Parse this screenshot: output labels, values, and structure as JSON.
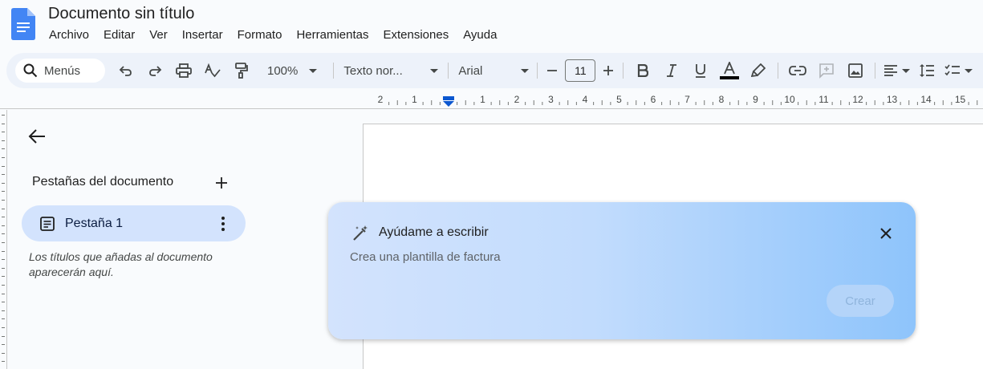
{
  "app": {
    "doc_title": "Documento sin título",
    "menu": [
      "Archivo",
      "Editar",
      "Ver",
      "Insertar",
      "Formato",
      "Herramientas",
      "Extensiones",
      "Ayuda"
    ]
  },
  "toolbar": {
    "search_placeholder": "Menús",
    "zoom": "100%",
    "style": "Texto nor...",
    "font": "Arial",
    "font_size": "11"
  },
  "ruler": {
    "labels": [
      "2",
      "1",
      "1",
      "2",
      "3",
      "4",
      "5",
      "6",
      "7",
      "8",
      "9",
      "10",
      "11",
      "12",
      "13",
      "14",
      "15"
    ]
  },
  "sidebar": {
    "tabs_title": "Pestañas del documento",
    "tab_label": "Pestaña 1",
    "hint": "Los títulos que añadas al documento aparecerán aquí."
  },
  "help_me_write": {
    "title": "Ayúdame a escribir",
    "prompt_value": "Crea una plantilla de factura",
    "create_label": "Crear"
  },
  "colors": {
    "accent": "#0b57d0",
    "chip": "#d3e3fd",
    "toolbar_bg": "#edf2fa"
  }
}
